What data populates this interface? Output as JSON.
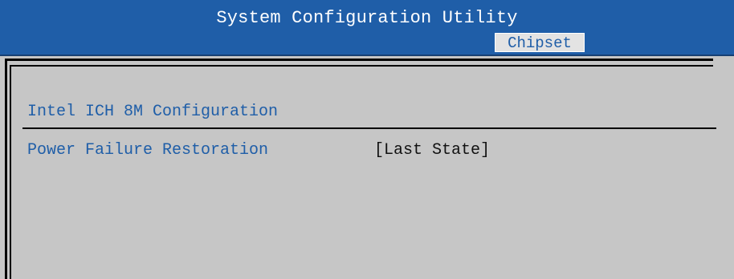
{
  "header": {
    "title": "System Configuration Utility",
    "active_tab": "Chipset"
  },
  "section": {
    "title": "Intel ICH 8M Configuration"
  },
  "settings": [
    {
      "label": "Power Failure Restoration",
      "value": "[Last State]"
    }
  ],
  "colors": {
    "title_bar": "#1f5ea8",
    "panel": "#c6c6c6",
    "label_text": "#1f5ea8",
    "value_text": "#111111"
  }
}
